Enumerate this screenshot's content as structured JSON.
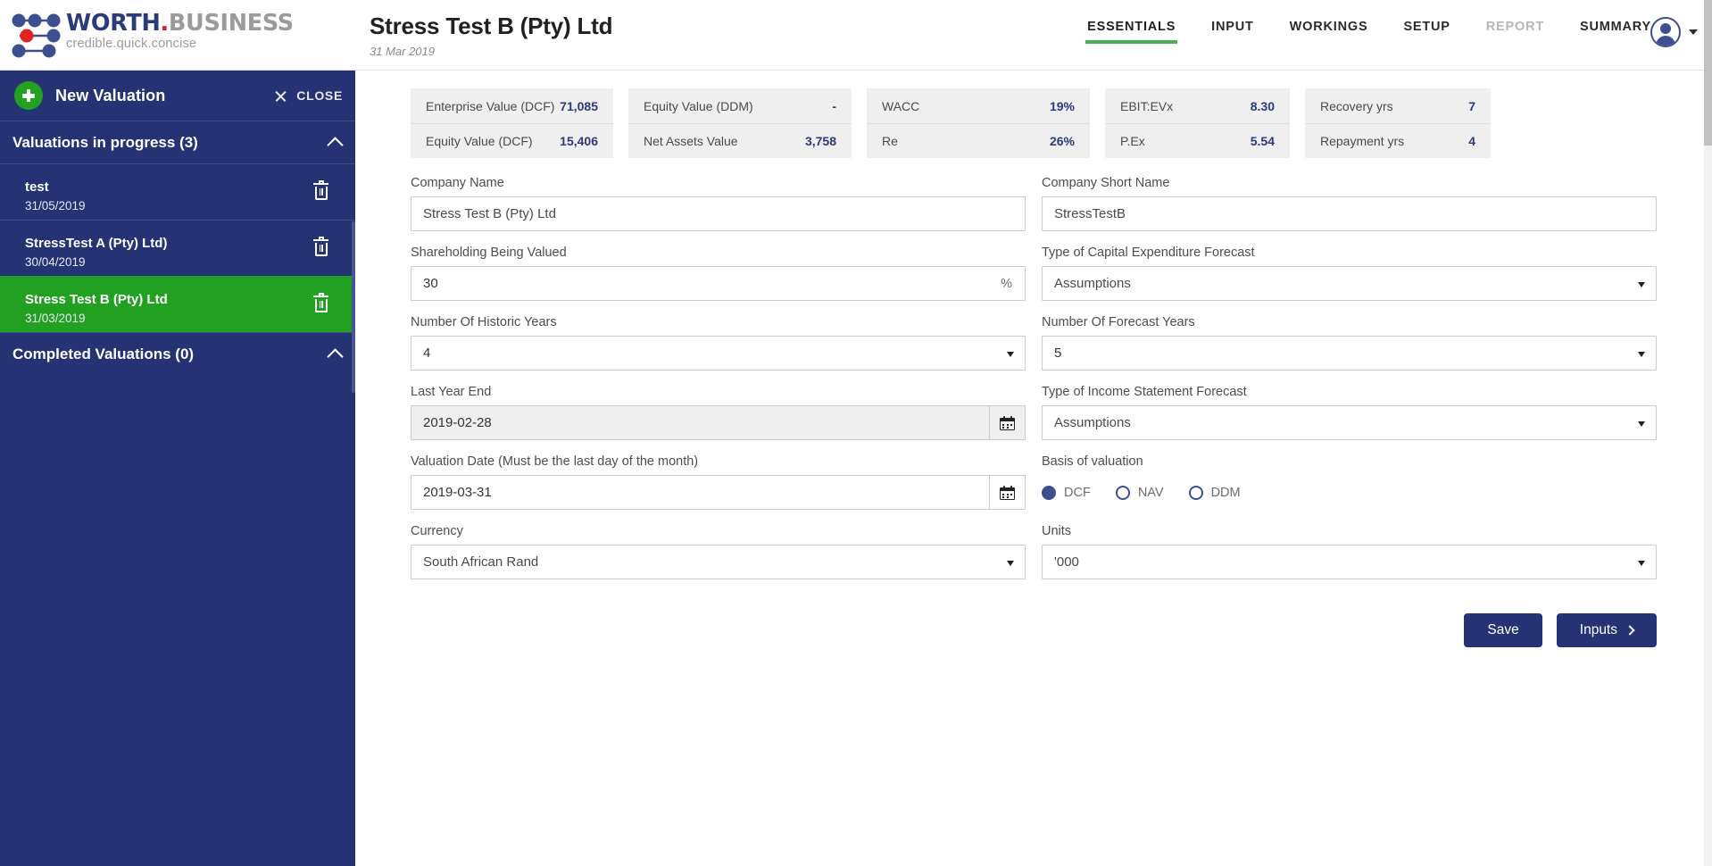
{
  "brand": {
    "name_part1": "WORTH",
    "name_dot": ".",
    "name_part2": "BUSINESS",
    "tagline": "credible.quick.concise"
  },
  "header": {
    "title": "Stress Test B (Pty) Ltd",
    "date": "31 Mar 2019",
    "nav": [
      {
        "label": "ESSENTIALS",
        "state": "active"
      },
      {
        "label": "INPUT",
        "state": "normal"
      },
      {
        "label": "WORKINGS",
        "state": "normal"
      },
      {
        "label": "SETUP",
        "state": "normal"
      },
      {
        "label": "REPORT",
        "state": "disabled"
      },
      {
        "label": "SUMMARY",
        "state": "normal"
      }
    ]
  },
  "sidebar": {
    "new_valuation_label": "New Valuation",
    "close_label": "CLOSE",
    "in_progress_header": "Valuations in progress (3)",
    "completed_header": "Completed Valuations (0)",
    "items": [
      {
        "name": "test",
        "date": "31/05/2019",
        "selected": false
      },
      {
        "name": "StressTest A (Pty) Ltd)",
        "date": "30/04/2019",
        "selected": false
      },
      {
        "name": "Stress Test B (Pty) Ltd",
        "date": "31/03/2019",
        "selected": true
      }
    ]
  },
  "kpis": [
    {
      "rows": [
        {
          "label": "Enterprise Value (DCF)",
          "value": "71,085"
        },
        {
          "label": "Equity Value (DCF)",
          "value": "15,406"
        }
      ]
    },
    {
      "rows": [
        {
          "label": "Equity Value (DDM)",
          "value": "-"
        },
        {
          "label": "Net Assets Value",
          "value": "3,758"
        }
      ]
    },
    {
      "rows": [
        {
          "label": "WACC",
          "value": "19%"
        },
        {
          "label": "Re",
          "value": "26%"
        }
      ]
    },
    {
      "rows": [
        {
          "label": "EBIT:EVx",
          "value": "8.30"
        },
        {
          "label": "P.Ex",
          "value": "5.54"
        }
      ]
    },
    {
      "rows": [
        {
          "label": "Recovery yrs",
          "value": "7"
        },
        {
          "label": "Repayment yrs",
          "value": "4"
        }
      ]
    }
  ],
  "form": {
    "company_name": {
      "label": "Company Name",
      "value": "Stress Test B (Pty) Ltd"
    },
    "company_short_name": {
      "label": "Company Short Name",
      "value": "StressTestB"
    },
    "shareholding": {
      "label": "Shareholding Being Valued",
      "value": "30",
      "suffix": "%"
    },
    "capex_forecast": {
      "label": "Type of Capital Expenditure Forecast",
      "value": "Assumptions"
    },
    "historic_years": {
      "label": "Number Of Historic Years",
      "value": "4"
    },
    "forecast_years": {
      "label": "Number Of Forecast Years",
      "value": "5"
    },
    "last_year_end": {
      "label": "Last Year End",
      "value": "2019-02-28"
    },
    "income_forecast": {
      "label": "Type of Income Statement Forecast",
      "value": "Assumptions"
    },
    "valuation_date": {
      "label": "Valuation Date (Must be the last day of the month)",
      "value": "2019-03-31"
    },
    "basis": {
      "label": "Basis of valuation",
      "options": [
        {
          "label": "DCF",
          "checked": true
        },
        {
          "label": "NAV",
          "checked": false
        },
        {
          "label": "DDM",
          "checked": false
        }
      ]
    },
    "currency": {
      "label": "Currency",
      "value": "South African Rand"
    },
    "units": {
      "label": "Units",
      "value": "'000"
    }
  },
  "actions": {
    "save_label": "Save",
    "inputs_label": "Inputs"
  },
  "colors": {
    "navy": "#253273",
    "green": "#22a022",
    "accent_blue": "#2b3a7a",
    "red": "#cc2222"
  }
}
